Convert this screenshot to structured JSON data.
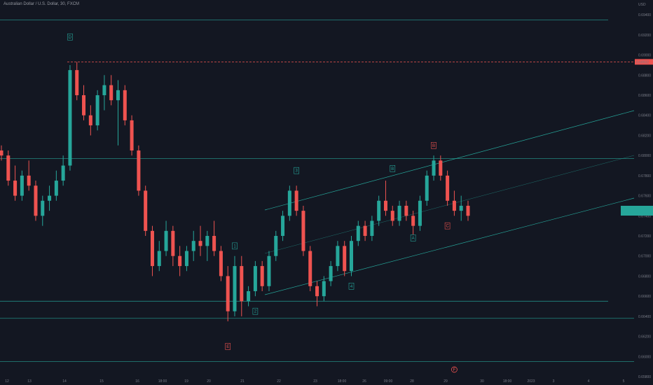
{
  "header": {
    "title": "Australian Dollar / U.S. Dollar, 30, FXCM"
  },
  "chart_data": {
    "type": "candlestick",
    "currency": "USD",
    "ylim": [
      0.658,
      0.6945
    ],
    "y_ticks": [
      "0.69400",
      "0.69200",
      "0.69000",
      "0.68800",
      "0.68600",
      "0.68400",
      "0.68200",
      "0.68000",
      "0.67800",
      "0.67600",
      "0.67400",
      "0.67200",
      "0.67000",
      "0.66800",
      "0.66600",
      "0.66400",
      "0.66200",
      "0.66000",
      "0.65800"
    ],
    "price_marker": "0.68932",
    "current_price_box": "",
    "x_ticks": [
      "12",
      "13",
      "14",
      "15",
      "16",
      "18:00",
      "19",
      "20",
      "21",
      "22",
      "23",
      "18:00",
      "26",
      "09:00",
      "28",
      "29",
      "30",
      "18:00",
      "2023",
      "3",
      "4",
      "5"
    ],
    "horizontal_levels": [
      0.6935,
      0.6797,
      0.6655,
      0.6638,
      0.6595
    ],
    "resistance_dashed": 0.68932,
    "series": [
      {
        "t": 0,
        "o": 0.6805,
        "h": 0.681,
        "l": 0.6795,
        "c": 0.68
      },
      {
        "t": 1,
        "o": 0.68,
        "h": 0.6805,
        "l": 0.677,
        "c": 0.6775
      },
      {
        "t": 2,
        "o": 0.6775,
        "h": 0.679,
        "l": 0.6755,
        "c": 0.676
      },
      {
        "t": 3,
        "o": 0.676,
        "h": 0.6785,
        "l": 0.6755,
        "c": 0.678
      },
      {
        "t": 4,
        "o": 0.678,
        "h": 0.6795,
        "l": 0.6765,
        "c": 0.677
      },
      {
        "t": 5,
        "o": 0.677,
        "h": 0.6775,
        "l": 0.6735,
        "c": 0.674
      },
      {
        "t": 6,
        "o": 0.674,
        "h": 0.676,
        "l": 0.673,
        "c": 0.6755
      },
      {
        "t": 7,
        "o": 0.6755,
        "h": 0.677,
        "l": 0.6745,
        "c": 0.676
      },
      {
        "t": 8,
        "o": 0.676,
        "h": 0.6785,
        "l": 0.6755,
        "c": 0.6775
      },
      {
        "t": 9,
        "o": 0.6775,
        "h": 0.68,
        "l": 0.677,
        "c": 0.679
      },
      {
        "t": 10,
        "o": 0.679,
        "h": 0.689,
        "l": 0.6785,
        "c": 0.6885
      },
      {
        "t": 11,
        "o": 0.6885,
        "h": 0.6893,
        "l": 0.6855,
        "c": 0.686
      },
      {
        "t": 12,
        "o": 0.686,
        "h": 0.687,
        "l": 0.6835,
        "c": 0.684
      },
      {
        "t": 13,
        "o": 0.684,
        "h": 0.685,
        "l": 0.682,
        "c": 0.683
      },
      {
        "t": 14,
        "o": 0.683,
        "h": 0.6865,
        "l": 0.6825,
        "c": 0.686
      },
      {
        "t": 15,
        "o": 0.686,
        "h": 0.688,
        "l": 0.6845,
        "c": 0.687
      },
      {
        "t": 16,
        "o": 0.687,
        "h": 0.688,
        "l": 0.685,
        "c": 0.6855
      },
      {
        "t": 17,
        "o": 0.6855,
        "h": 0.6875,
        "l": 0.681,
        "c": 0.6865
      },
      {
        "t": 18,
        "o": 0.6865,
        "h": 0.687,
        "l": 0.683,
        "c": 0.6835
      },
      {
        "t": 19,
        "o": 0.6835,
        "h": 0.684,
        "l": 0.68,
        "c": 0.6805
      },
      {
        "t": 20,
        "o": 0.6805,
        "h": 0.681,
        "l": 0.676,
        "c": 0.6765
      },
      {
        "t": 21,
        "o": 0.6765,
        "h": 0.677,
        "l": 0.672,
        "c": 0.6725
      },
      {
        "t": 22,
        "o": 0.6725,
        "h": 0.673,
        "l": 0.668,
        "c": 0.669
      },
      {
        "t": 23,
        "o": 0.669,
        "h": 0.6715,
        "l": 0.6685,
        "c": 0.6705
      },
      {
        "t": 24,
        "o": 0.6705,
        "h": 0.6735,
        "l": 0.67,
        "c": 0.6725
      },
      {
        "t": 25,
        "o": 0.6725,
        "h": 0.673,
        "l": 0.669,
        "c": 0.67
      },
      {
        "t": 26,
        "o": 0.67,
        "h": 0.671,
        "l": 0.668,
        "c": 0.669
      },
      {
        "t": 27,
        "o": 0.669,
        "h": 0.671,
        "l": 0.6685,
        "c": 0.6705
      },
      {
        "t": 28,
        "o": 0.6705,
        "h": 0.6725,
        "l": 0.6695,
        "c": 0.6715
      },
      {
        "t": 29,
        "o": 0.6715,
        "h": 0.673,
        "l": 0.67,
        "c": 0.671
      },
      {
        "t": 30,
        "o": 0.671,
        "h": 0.6725,
        "l": 0.6695,
        "c": 0.672
      },
      {
        "t": 31,
        "o": 0.672,
        "h": 0.6735,
        "l": 0.67,
        "c": 0.6705
      },
      {
        "t": 32,
        "o": 0.6705,
        "h": 0.671,
        "l": 0.6675,
        "c": 0.668
      },
      {
        "t": 33,
        "o": 0.668,
        "h": 0.669,
        "l": 0.6635,
        "c": 0.6645
      },
      {
        "t": 34,
        "o": 0.6645,
        "h": 0.67,
        "l": 0.664,
        "c": 0.669
      },
      {
        "t": 35,
        "o": 0.669,
        "h": 0.67,
        "l": 0.664,
        "c": 0.6655
      },
      {
        "t": 36,
        "o": 0.6655,
        "h": 0.667,
        "l": 0.665,
        "c": 0.6665
      },
      {
        "t": 37,
        "o": 0.6665,
        "h": 0.6695,
        "l": 0.666,
        "c": 0.669
      },
      {
        "t": 38,
        "o": 0.669,
        "h": 0.6695,
        "l": 0.6665,
        "c": 0.667
      },
      {
        "t": 39,
        "o": 0.667,
        "h": 0.6705,
        "l": 0.6665,
        "c": 0.67
      },
      {
        "t": 40,
        "o": 0.67,
        "h": 0.6725,
        "l": 0.6695,
        "c": 0.672
      },
      {
        "t": 41,
        "o": 0.672,
        "h": 0.6745,
        "l": 0.6715,
        "c": 0.674
      },
      {
        "t": 42,
        "o": 0.674,
        "h": 0.677,
        "l": 0.6735,
        "c": 0.6765
      },
      {
        "t": 43,
        "o": 0.6765,
        "h": 0.677,
        "l": 0.674,
        "c": 0.6745
      },
      {
        "t": 44,
        "o": 0.6745,
        "h": 0.675,
        "l": 0.67,
        "c": 0.6705
      },
      {
        "t": 45,
        "o": 0.6705,
        "h": 0.671,
        "l": 0.6665,
        "c": 0.667
      },
      {
        "t": 46,
        "o": 0.667,
        "h": 0.6675,
        "l": 0.665,
        "c": 0.666
      },
      {
        "t": 47,
        "o": 0.666,
        "h": 0.668,
        "l": 0.6655,
        "c": 0.6675
      },
      {
        "t": 48,
        "o": 0.6675,
        "h": 0.6695,
        "l": 0.667,
        "c": 0.669
      },
      {
        "t": 49,
        "o": 0.669,
        "h": 0.6715,
        "l": 0.6685,
        "c": 0.671
      },
      {
        "t": 50,
        "o": 0.671,
        "h": 0.6715,
        "l": 0.668,
        "c": 0.6685
      },
      {
        "t": 51,
        "o": 0.6685,
        "h": 0.672,
        "l": 0.668,
        "c": 0.6715
      },
      {
        "t": 52,
        "o": 0.6715,
        "h": 0.6735,
        "l": 0.671,
        "c": 0.673
      },
      {
        "t": 53,
        "o": 0.673,
        "h": 0.6735,
        "l": 0.6715,
        "c": 0.672
      },
      {
        "t": 54,
        "o": 0.672,
        "h": 0.674,
        "l": 0.6715,
        "c": 0.6735
      },
      {
        "t": 55,
        "o": 0.6735,
        "h": 0.676,
        "l": 0.673,
        "c": 0.6755
      },
      {
        "t": 56,
        "o": 0.6755,
        "h": 0.6775,
        "l": 0.674,
        "c": 0.6745
      },
      {
        "t": 57,
        "o": 0.6745,
        "h": 0.675,
        "l": 0.673,
        "c": 0.6735
      },
      {
        "t": 58,
        "o": 0.6735,
        "h": 0.6755,
        "l": 0.673,
        "c": 0.675
      },
      {
        "t": 59,
        "o": 0.675,
        "h": 0.6755,
        "l": 0.6735,
        "c": 0.674
      },
      {
        "t": 60,
        "o": 0.674,
        "h": 0.6745,
        "l": 0.672,
        "c": 0.673
      },
      {
        "t": 61,
        "o": 0.673,
        "h": 0.676,
        "l": 0.6725,
        "c": 0.6755
      },
      {
        "t": 62,
        "o": 0.6755,
        "h": 0.6785,
        "l": 0.675,
        "c": 0.678
      },
      {
        "t": 63,
        "o": 0.678,
        "h": 0.68,
        "l": 0.6775,
        "c": 0.6795
      },
      {
        "t": 64,
        "o": 0.6795,
        "h": 0.68,
        "l": 0.6775,
        "c": 0.678
      },
      {
        "t": 65,
        "o": 0.678,
        "h": 0.6785,
        "l": 0.675,
        "c": 0.6755
      },
      {
        "t": 66,
        "o": 0.6755,
        "h": 0.6765,
        "l": 0.674,
        "c": 0.6745
      },
      {
        "t": 67,
        "o": 0.6745,
        "h": 0.676,
        "l": 0.6735,
        "c": 0.675
      },
      {
        "t": 68,
        "o": 0.675,
        "h": 0.6755,
        "l": 0.6735,
        "c": 0.674
      }
    ],
    "wave_labels": [
      {
        "text": "D",
        "x": 10,
        "p": 0.6918,
        "color": "#26a69a"
      },
      {
        "text": "E",
        "x": 33,
        "p": 0.661,
        "color": "#ef5350"
      },
      {
        "text": "1",
        "x": 34,
        "p": 0.671,
        "color": "#26a69a"
      },
      {
        "text": "2",
        "x": 37,
        "p": 0.6645,
        "color": "#26a69a"
      },
      {
        "text": "3",
        "x": 43,
        "p": 0.6785,
        "color": "#26a69a"
      },
      {
        "text": "4",
        "x": 51,
        "p": 0.667,
        "color": "#26a69a"
      },
      {
        "text": "B",
        "x": 57,
        "p": 0.6787,
        "color": "#26a69a"
      },
      {
        "text": "A",
        "x": 60,
        "p": 0.6718,
        "color": "#26a69a"
      },
      {
        "text": "B",
        "x": 63,
        "p": 0.681,
        "color": "#ef5350"
      },
      {
        "text": "C",
        "x": 65,
        "p": 0.673,
        "color": "#ef5350"
      },
      {
        "text": "F",
        "x": 66,
        "p": 0.6587,
        "color": "#ef5350"
      }
    ]
  }
}
